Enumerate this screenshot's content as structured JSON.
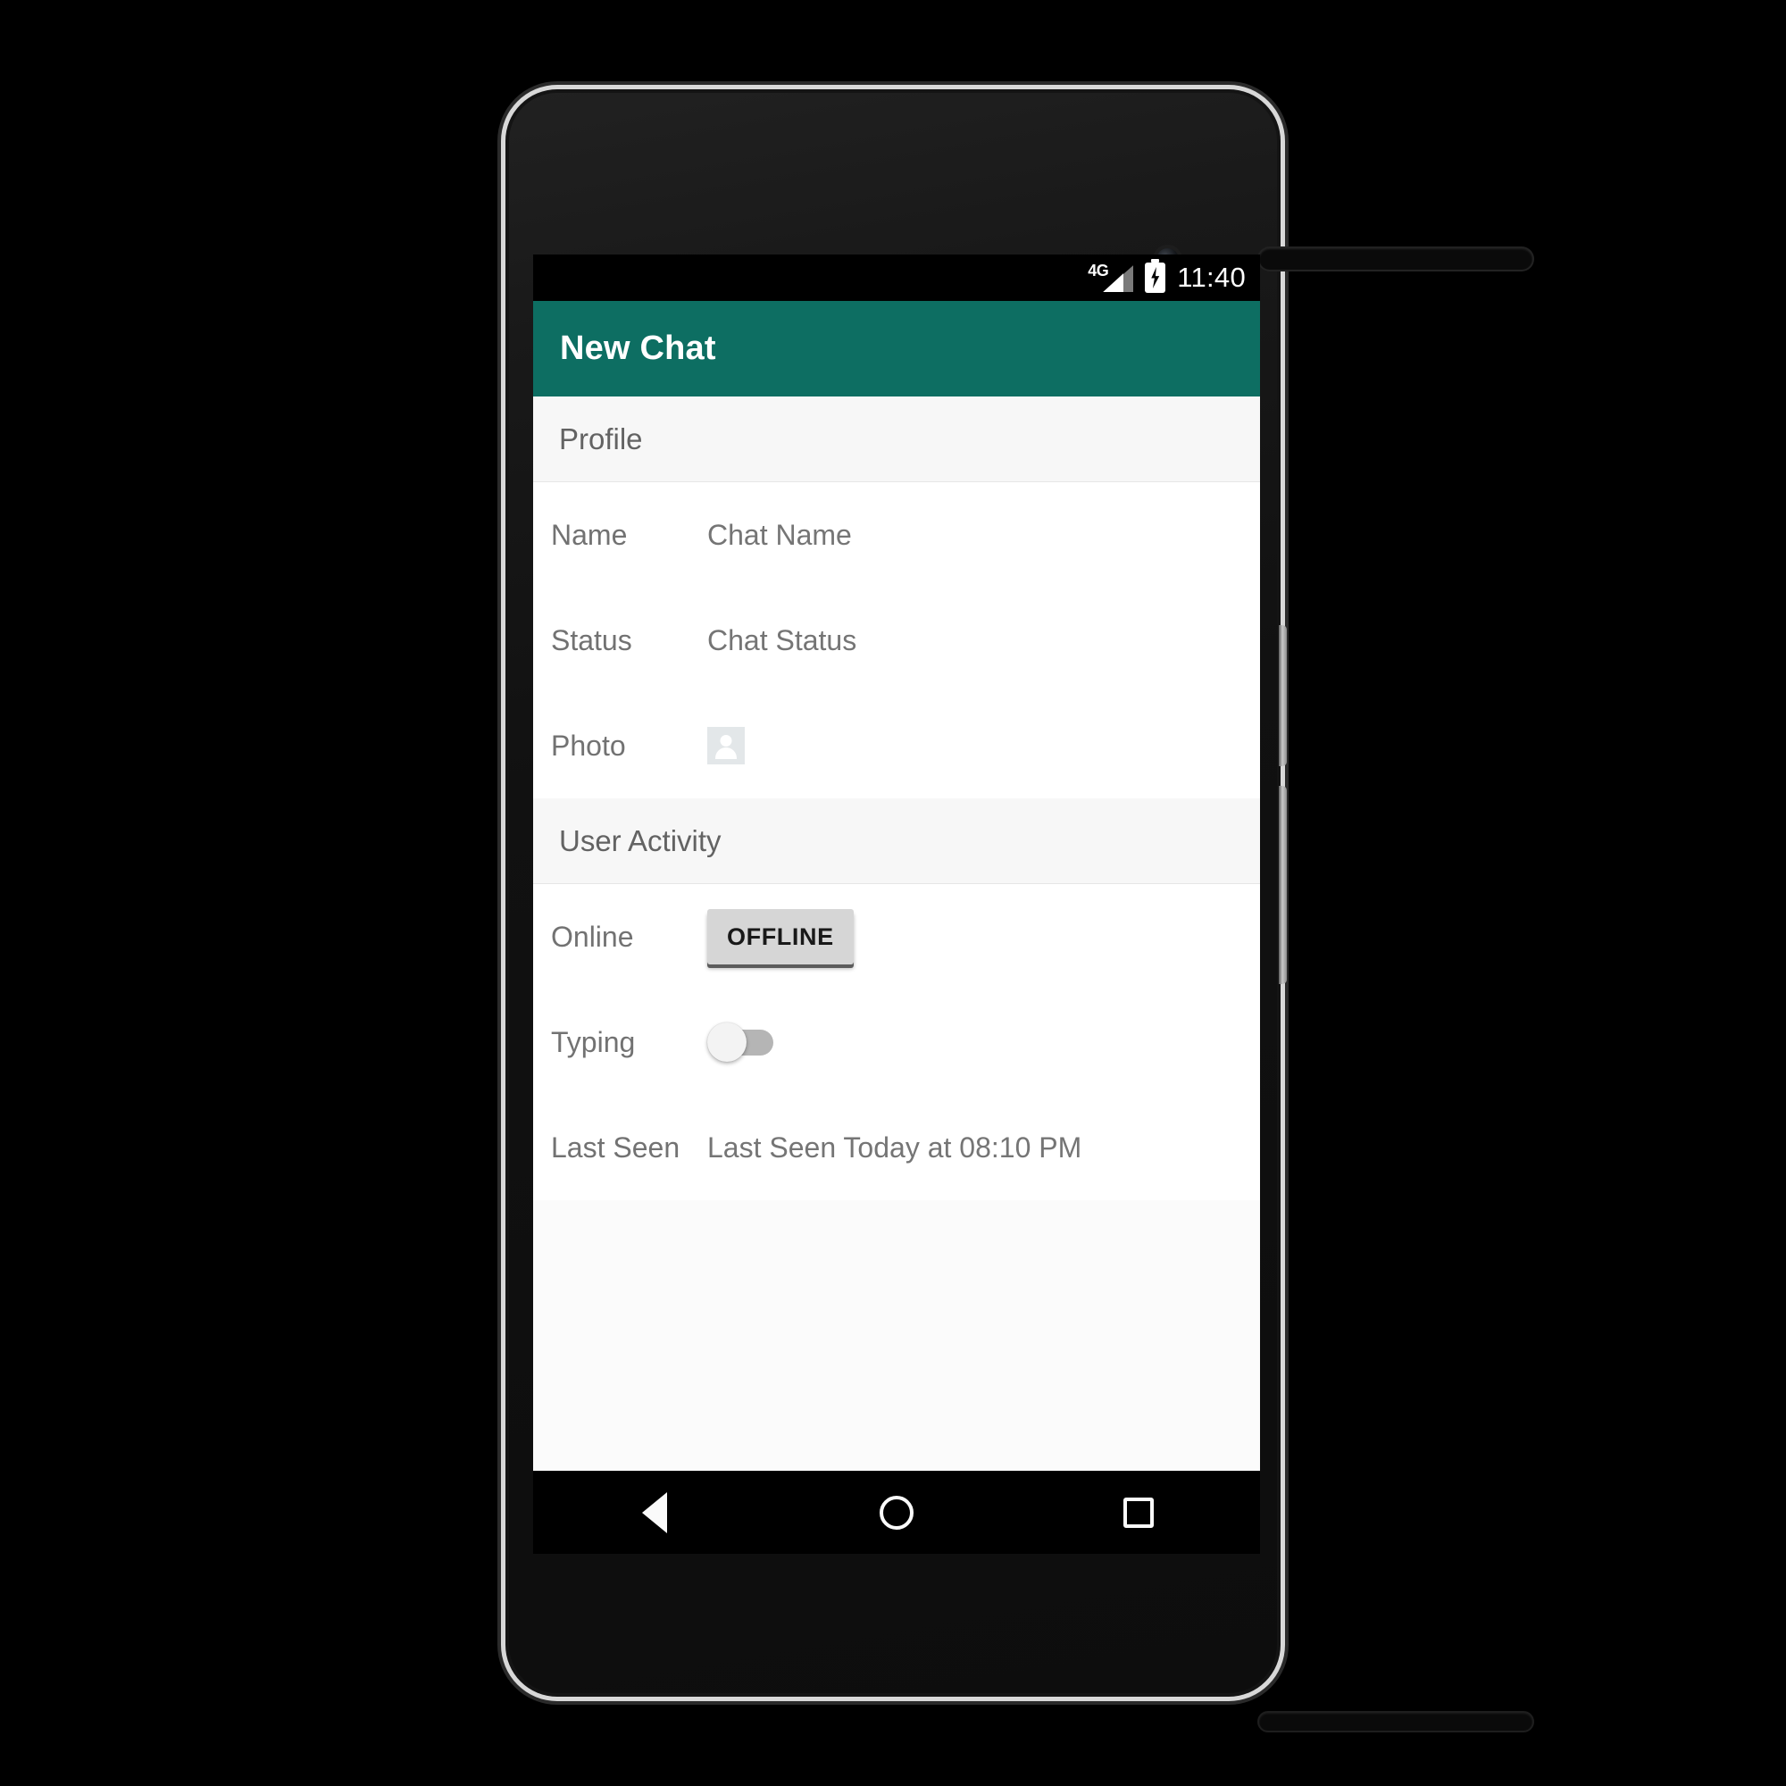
{
  "device": {
    "camera_icon": "front-camera-icon",
    "earpiece_icon": "earpiece-speaker-icon",
    "bottom_speaker_icon": "bottom-speaker-icon",
    "volume_button": "volume-rocker",
    "power_button": "power-button"
  },
  "status_bar": {
    "network_label": "4G",
    "signal_icon": "signal-bars-icon",
    "battery_icon": "battery-charging-icon",
    "time": "11:40"
  },
  "app_bar": {
    "title": "New Chat",
    "background": "#0d6e62"
  },
  "sections": [
    {
      "header": "Profile",
      "rows": [
        {
          "label": "Name",
          "value": "Chat Name",
          "type": "text"
        },
        {
          "label": "Status",
          "value": "Chat Status",
          "type": "text"
        },
        {
          "label": "Photo",
          "value": "",
          "type": "avatar",
          "icon": "person-placeholder-icon"
        }
      ]
    },
    {
      "header": "User Activity",
      "rows": [
        {
          "label": "Online",
          "value": "OFFLINE",
          "type": "button"
        },
        {
          "label": "Typing",
          "value": "off",
          "type": "switch"
        },
        {
          "label": "Last Seen",
          "value": "Last Seen Today at 08:10 PM",
          "type": "text"
        }
      ]
    }
  ],
  "nav_bar": {
    "back": "back-button",
    "home": "home-button",
    "recents": "recents-button"
  }
}
